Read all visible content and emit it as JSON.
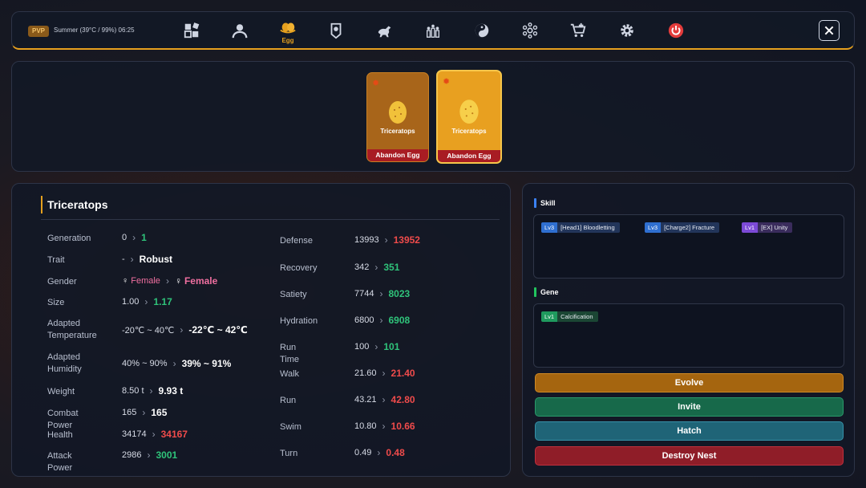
{
  "topbar": {
    "mode_badge": "PVP",
    "weather": "Summer (39°C / 99%) 06:25",
    "active_tab_label": "Egg",
    "nav": [
      "grid-icon",
      "profile-icon",
      "egg-icon",
      "badge-icon",
      "dino-icon",
      "group-icon",
      "yin-yang-icon",
      "cluster-icon",
      "shop-cart-icon",
      "gear-icon",
      "power-icon"
    ],
    "accent_color": "#e6a01e"
  },
  "eggs": [
    {
      "species": "Triceratops",
      "action": "Abandon Egg",
      "selected": false
    },
    {
      "species": "Triceratops",
      "action": "Abandon Egg",
      "selected": true
    }
  ],
  "stats": {
    "title": "Triceratops",
    "left": [
      {
        "label": "Generation",
        "old": "0",
        "new": "1"
      },
      {
        "label": "Trait",
        "old": "-",
        "new": "Robust"
      },
      {
        "label": "Gender",
        "old": "Female",
        "new": "Female"
      },
      {
        "label": "Size",
        "old": "1.00",
        "new": "1.17"
      },
      {
        "label": "Adapted Temperature",
        "old": "-20℃ ~ 40℃",
        "new": "-22℃ ~ 42℃"
      },
      {
        "label": "Adapted Humidity",
        "old": "40% ~ 90%",
        "new": "39% ~ 91%"
      },
      {
        "label": "Weight",
        "old": "8.50 t",
        "new": "9.93 t"
      },
      {
        "label": "Combat Power",
        "old": "165",
        "new": "165"
      },
      {
        "label": "Health",
        "old": "34174",
        "new": "34167"
      },
      {
        "label": "Attack Power",
        "old": "2986",
        "new": "3001"
      }
    ],
    "right": [
      {
        "label": "Defense",
        "old": "13993",
        "new": "13952"
      },
      {
        "label": "Recovery",
        "old": "342",
        "new": "351"
      },
      {
        "label": "Satiety",
        "old": "7744",
        "new": "8023"
      },
      {
        "label": "Hydration",
        "old": "6800",
        "new": "6908"
      },
      {
        "label": "Run Time",
        "old": "100",
        "new": "101"
      },
      {
        "label": "Walk",
        "old": "21.60",
        "new": "21.40"
      },
      {
        "label": "Run",
        "old": "43.21",
        "new": "42.80"
      },
      {
        "label": "Swim",
        "old": "10.80",
        "new": "10.66"
      },
      {
        "label": "Turn",
        "old": "0.49",
        "new": "0.48"
      }
    ]
  },
  "skill": {
    "title": "Skill",
    "tags": [
      {
        "level": "Lv3",
        "text": "[Head1]    Bloodletting"
      },
      {
        "level": "Lv3",
        "text": "[Charge2]    Fracture"
      },
      {
        "level": "Lv1",
        "text": "[EX]    Unity"
      }
    ]
  },
  "gene": {
    "title": "Gene",
    "tags": [
      {
        "level": "Lv1",
        "text": "Calcification"
      }
    ]
  },
  "actions": {
    "evolve": "Evolve",
    "invite": "Invite",
    "hatch": "Hatch",
    "destroy": "Destroy Nest"
  }
}
